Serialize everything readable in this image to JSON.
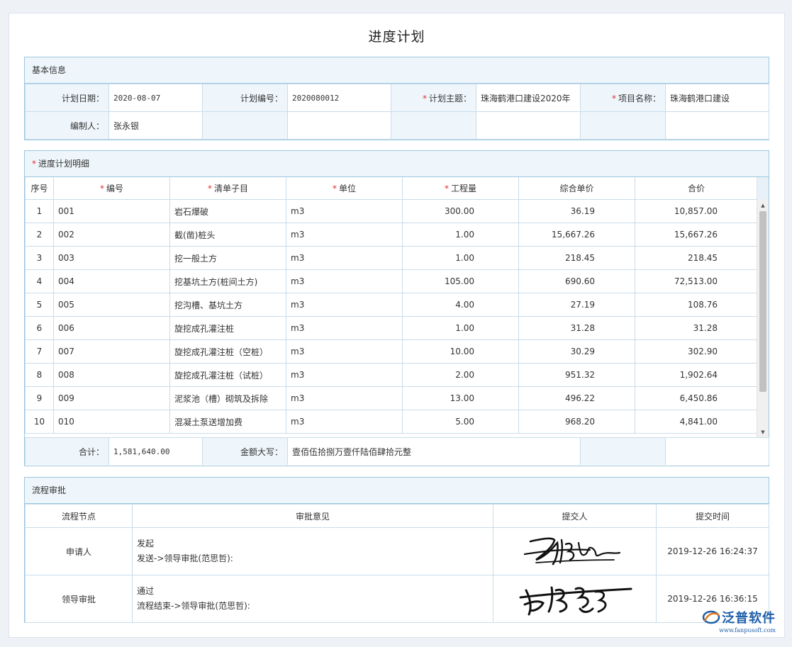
{
  "page_title": "进度计划",
  "basic": {
    "section_title": "基本信息",
    "plan_date_label": "计划日期：",
    "plan_date": "2020-08-07",
    "plan_no_label": "计划编号：",
    "plan_no": "2020080012",
    "plan_subject_label": "计划主题：",
    "plan_subject": "珠海鹤港口建设2020年",
    "project_name_label": "项目名称：",
    "project_name": "珠海鹤港口建设",
    "editor_label": "编制人：",
    "editor": "张永银"
  },
  "detail": {
    "section_title": "进度计划明细",
    "columns": [
      "序号",
      "编号",
      "清单子目",
      "单位",
      "工程量",
      "综合单价",
      "合价"
    ],
    "rows": [
      [
        "1",
        "001",
        "岩石爆破",
        "m3",
        "300.00",
        "36.19",
        "10,857.00"
      ],
      [
        "2",
        "002",
        "截(凿)桩头",
        "m3",
        "1.00",
        "15,667.26",
        "15,667.26"
      ],
      [
        "3",
        "003",
        "挖一般土方",
        "m3",
        "1.00",
        "218.45",
        "218.45"
      ],
      [
        "4",
        "004",
        "挖基坑土方(桩间土方)",
        "m3",
        "105.00",
        "690.60",
        "72,513.00"
      ],
      [
        "5",
        "005",
        "挖沟槽、基坑土方",
        "m3",
        "4.00",
        "27.19",
        "108.76"
      ],
      [
        "6",
        "006",
        "旋挖成孔灌注桩",
        "m3",
        "1.00",
        "31.28",
        "31.28"
      ],
      [
        "7",
        "007",
        "旋挖成孔灌注桩（空桩）",
        "m3",
        "10.00",
        "30.29",
        "302.90"
      ],
      [
        "8",
        "008",
        "旋挖成孔灌注桩（试桩）",
        "m3",
        "2.00",
        "951.32",
        "1,902.64"
      ],
      [
        "9",
        "009",
        "泥浆池（槽）砌筑及拆除",
        "m3",
        "13.00",
        "496.22",
        "6,450.86"
      ],
      [
        "10",
        "010",
        "混凝土泵送增加费",
        "m3",
        "5.00",
        "968.20",
        "4,841.00"
      ]
    ],
    "total_label": "合计：",
    "total_value": "1,581,640.00",
    "amount_words_label": "金额大写：",
    "amount_words": "壹佰伍拾捌万壹仟陆佰肆拾元整"
  },
  "flow": {
    "section_title": "流程审批",
    "columns": [
      "流程节点",
      "审批意见",
      "提交人",
      "提交时间"
    ],
    "rows": [
      {
        "node": "申请人",
        "opinion": "发起",
        "detail": "发送->领导审批(范思哲):",
        "time": "2019-12-26 16:24:37"
      },
      {
        "node": "领导审批",
        "opinion": "通过",
        "detail": "流程结束->领导审批(范思哲):",
        "time": "2019-12-26 16:36:15"
      }
    ]
  },
  "brand": {
    "name": "泛普软件",
    "url": "www.fanpusoft.com"
  }
}
